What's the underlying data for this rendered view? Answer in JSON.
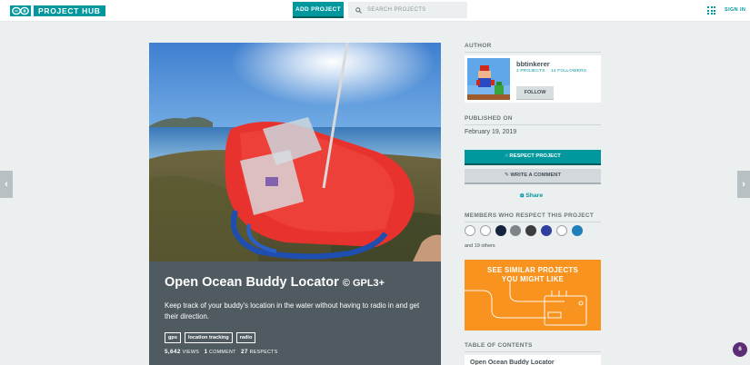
{
  "header": {
    "logo_text": "PROJECT HUB",
    "add_project_label": "ADD PROJECT",
    "search_placeholder": "SEARCH PROJECTS",
    "sign_in_label": "SIGN IN"
  },
  "project": {
    "title": "Open Ocean Buddy Locator",
    "license": "© GPL3+",
    "description": "Keep track of your buddy's location in the water without having to radio in and get their direction.",
    "tags": [
      "gps",
      "location tracking",
      "radio"
    ],
    "views_count": "5,642",
    "views_label": "VIEWS",
    "comments_count": "1",
    "comments_label": "COMMENT",
    "respects_count": "27",
    "respects_label": "RESPECTS"
  },
  "sidebar": {
    "author_heading": "AUTHOR",
    "author_name": "bbtinkerer",
    "author_projects": "2 PROJECTS",
    "author_followers": "14 FOLLOWERS",
    "follow_label": "FOLLOW",
    "published_heading": "PUBLISHED ON",
    "published_date": "February 19, 2019",
    "respect_label": "RESPECT PROJECT",
    "comment_label": "WRITE A COMMENT",
    "share_label": "Share",
    "members_heading": "MEMBERS WHO RESPECT THIS PROJECT",
    "others_text": "and 19 others",
    "promo_line1": "SEE SIMILAR PROJECTS",
    "promo_line2": "YOU MIGHT LIKE",
    "toc_heading": "TABLE OF CONTENTS",
    "toc_first_item": "Open Ocean Buddy Locator"
  },
  "notification_count": "6",
  "colors": {
    "accent": "#00979d",
    "hero_panel": "#4f5b60",
    "promo": "#f7931e",
    "notification": "#5c2c74"
  },
  "icons": {
    "logo": "arduino-infinity-logo",
    "search": "search-icon",
    "apps": "grid-icon",
    "respect": "thumbs-up-icon",
    "comment": "pencil-icon",
    "share": "share-icon",
    "prev": "chevron-left-icon",
    "next": "chevron-right-icon"
  }
}
